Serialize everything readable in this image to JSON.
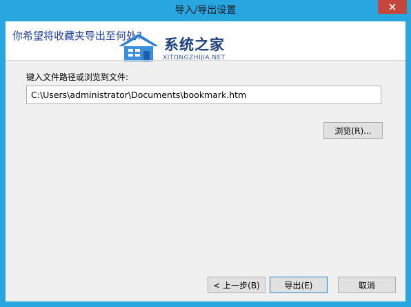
{
  "window": {
    "title": "导入/导出设置"
  },
  "header": {
    "prompt": "你希望将收藏夹导出至何处?"
  },
  "watermark": {
    "brand": "系统之家",
    "subtitle": "XITONGZHIJIA.NET"
  },
  "form": {
    "label": "键入文件路径或浏览到文件:",
    "path_value": "C:\\Users\\administrator\\Documents\\bookmark.htm",
    "browse_label": "浏览(R)..."
  },
  "footer": {
    "back_label": "< 上一步(B)",
    "export_label": "导出(E)",
    "cancel_label": "取消"
  },
  "colors": {
    "titlebar": "#28a6e0",
    "close_button": "#c7463b",
    "prompt_text": "#1e3e9e"
  }
}
